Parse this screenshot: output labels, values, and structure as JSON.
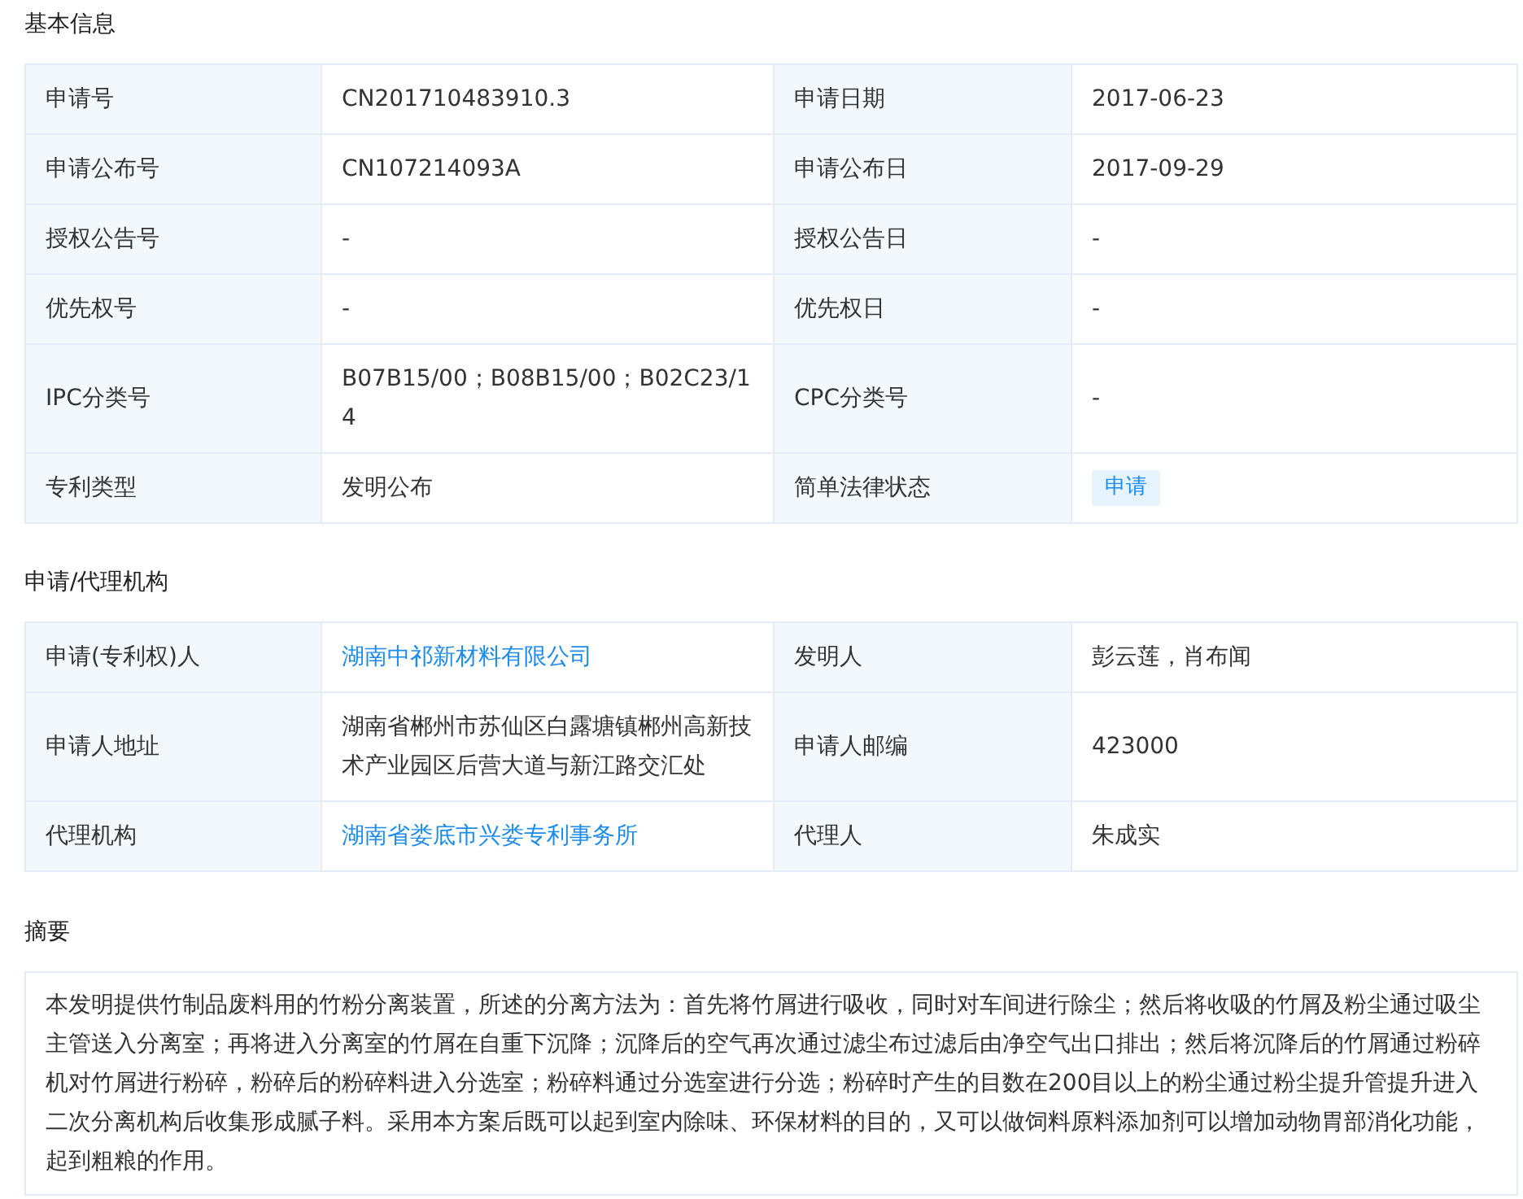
{
  "basic_info": {
    "title": "基本信息",
    "rows": [
      [
        {
          "label": "申请号",
          "value": "CN201710483910.3",
          "kind": "text"
        },
        {
          "label": "申请日期",
          "value": "2017-06-23",
          "kind": "text"
        }
      ],
      [
        {
          "label": "申请公布号",
          "value": "CN107214093A",
          "kind": "text"
        },
        {
          "label": "申请公布日",
          "value": "2017-09-29",
          "kind": "text"
        }
      ],
      [
        {
          "label": "授权公告号",
          "value": "-",
          "kind": "text"
        },
        {
          "label": "授权公告日",
          "value": "-",
          "kind": "text"
        }
      ],
      [
        {
          "label": "优先权号",
          "value": "-",
          "kind": "text"
        },
        {
          "label": "优先权日",
          "value": "-",
          "kind": "text"
        }
      ],
      [
        {
          "label": "IPC分类号",
          "value": "B07B15/00；B08B15/00；B02C23/14",
          "kind": "text"
        },
        {
          "label": "CPC分类号",
          "value": "-",
          "kind": "text"
        }
      ],
      [
        {
          "label": "专利类型",
          "value": "发明公布",
          "kind": "text"
        },
        {
          "label": "简单法律状态",
          "value": "申请",
          "kind": "tag"
        }
      ]
    ]
  },
  "agency": {
    "title": "申请/代理机构",
    "rows": [
      [
        {
          "label": "申请(专利权)人",
          "value": "湖南中祁新材料有限公司",
          "kind": "link"
        },
        {
          "label": "发明人",
          "value": "彭云莲，肖布闻",
          "kind": "text"
        }
      ],
      [
        {
          "label": "申请人地址",
          "value": "湖南省郴州市苏仙区白露塘镇郴州高新技术产业园区后营大道与新江路交汇处",
          "kind": "text"
        },
        {
          "label": "申请人邮编",
          "value": "423000",
          "kind": "text"
        }
      ],
      [
        {
          "label": "代理机构",
          "value": "湖南省娄底市兴娄专利事务所",
          "kind": "link"
        },
        {
          "label": "代理人",
          "value": "朱成实",
          "kind": "text"
        }
      ]
    ]
  },
  "abstract": {
    "title": "摘要",
    "text": "本发明提供竹制品废料用的竹粉分离装置，所述的分离方法为：首先将竹屑进行吸收，同时对车间进行除尘；然后将收吸的竹屑及粉尘通过吸尘主管送入分离室；再将进入分离室的竹屑在自重下沉降；沉降后的空气再次通过滤尘布过滤后由净空气出口排出；然后将沉降后的竹屑通过粉碎机对竹屑进行粉碎，粉碎后的粉碎料进入分选室；粉碎料通过分选室进行分选；粉碎时产生的目数在200目以上的粉尘通过粉尘提升管提升进入二次分离机构后收集形成腻子料。采用本方案后既可以起到室内除味、环保材料的目的，又可以做饲料原料添加剂可以增加动物胃部消化功能，起到粗粮的作用。"
  }
}
